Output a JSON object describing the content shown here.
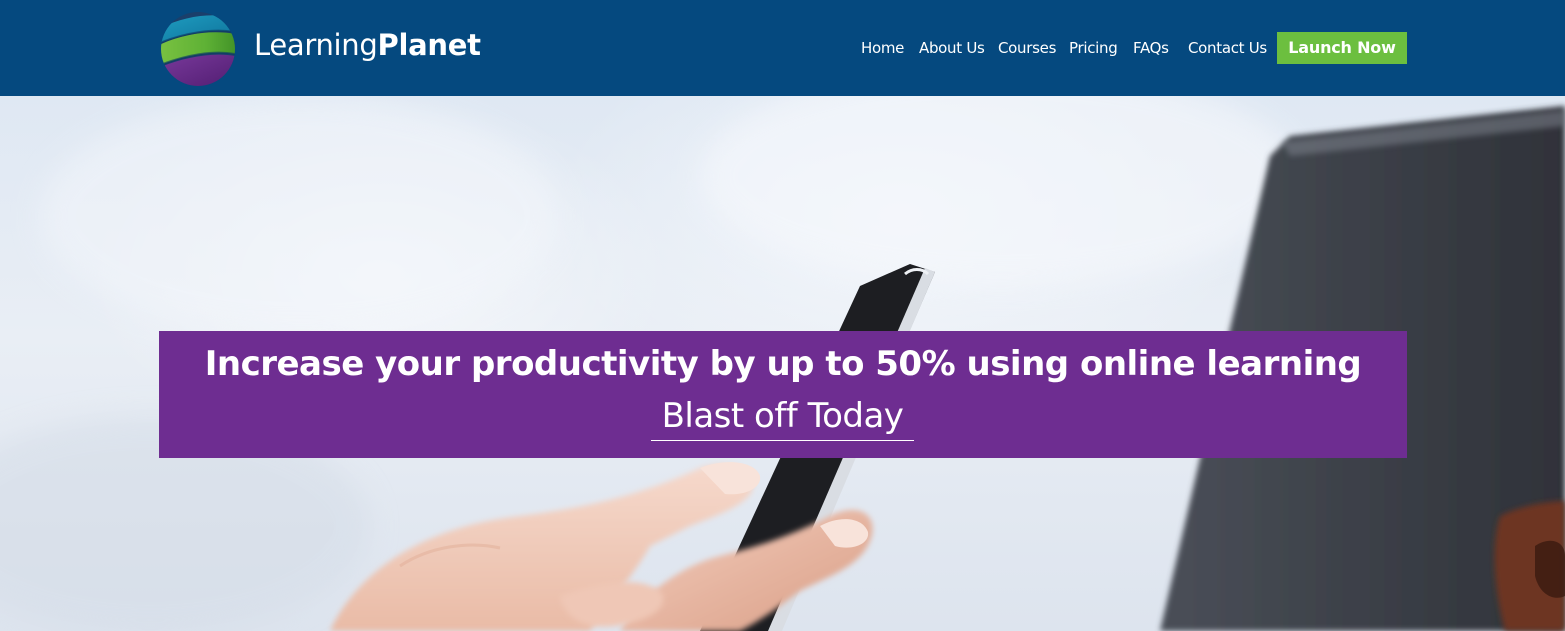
{
  "brand": {
    "name_light": "Learning",
    "name_bold": "Planet"
  },
  "nav": {
    "home": "Home",
    "about": "About Us",
    "courses": "Courses",
    "pricing": "Pricing",
    "faqs": "FAQs",
    "contact": "Contact Us",
    "launch": "Launch Now"
  },
  "hero": {
    "headline": "Increase your productivity by up to 50% using online learning",
    "cta": "Blast off Today"
  },
  "colors": {
    "header_bg": "#05497f",
    "launch_button": "#6cbf3f",
    "banner_bg": "#6e2d91",
    "text": "#ffffff"
  }
}
